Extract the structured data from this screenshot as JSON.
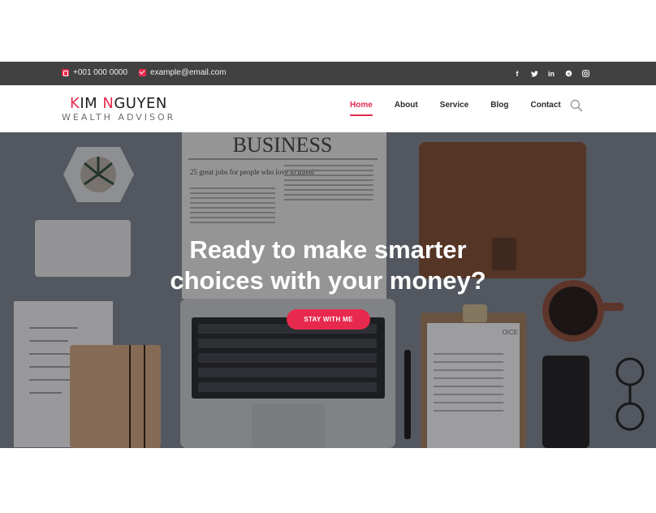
{
  "topbar": {
    "phone": "+001 000 0000",
    "email": "example@email.com",
    "social": [
      {
        "icon": "facebook-icon",
        "glyph": "f"
      },
      {
        "icon": "twitter-icon",
        "glyph": "t"
      },
      {
        "icon": "linkedin-icon",
        "glyph": "in"
      },
      {
        "icon": "skype-icon",
        "glyph": "s"
      },
      {
        "icon": "instagram-icon",
        "glyph": "◎"
      }
    ]
  },
  "logo": {
    "first_letter": "K",
    "name_rest": "IM ",
    "second_letter": "N",
    "surname_rest": "GUYEN",
    "tagline": "WEALTH ADVISOR"
  },
  "nav": {
    "items": [
      "Home",
      "About",
      "Service",
      "Blog",
      "Contact"
    ],
    "active": "Home"
  },
  "hero": {
    "headline_line1": "Ready to make smarter",
    "headline_line2": "choices with your money?",
    "cta_label": "STAY WITH ME",
    "newspaper_title": "BUSINESS",
    "newspaper_subtitle": "25 great jobs for people who love to travel",
    "invoice_label": "OICE"
  },
  "colors": {
    "accent": "#e8294e",
    "topbar_bg": "#414141"
  }
}
